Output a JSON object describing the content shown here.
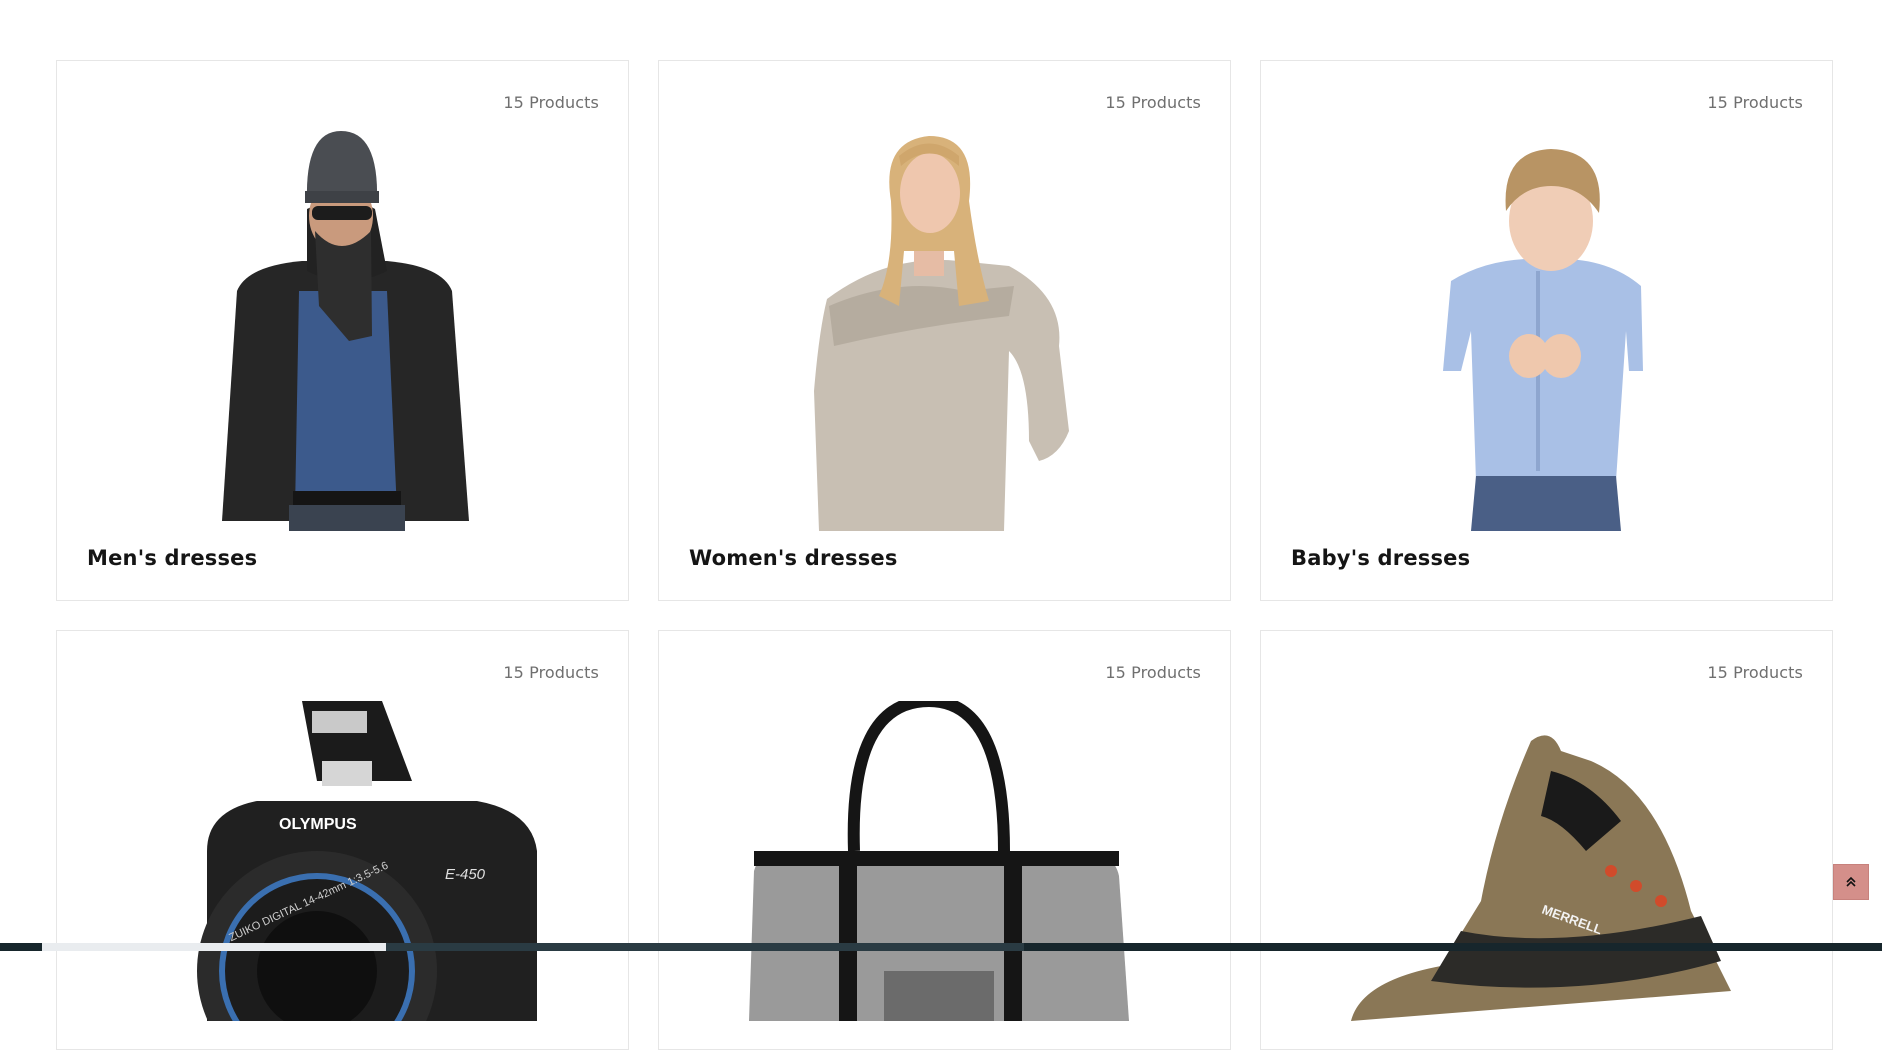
{
  "categories": [
    {
      "count_label": "15 Products",
      "title": "Men's dresses",
      "image_icon": "man-in-jacket-photo"
    },
    {
      "count_label": "15 Products",
      "title": "Women's dresses",
      "image_icon": "woman-in-sweater-photo"
    },
    {
      "count_label": "15 Products",
      "title": "Baby's dresses",
      "image_icon": "boy-in-shirt-photo"
    },
    {
      "count_label": "15 Products",
      "title": "",
      "image_icon": "camera-photo",
      "image_text": {
        "brand": "OLYMPUS",
        "model": "E-450",
        "lens": "ZUIKO DIGITAL 14-42mm 1:3.5-5.6"
      }
    },
    {
      "count_label": "15 Products",
      "title": "",
      "image_icon": "handbag-photo"
    },
    {
      "count_label": "15 Products",
      "title": "",
      "image_icon": "hiking-shoe-photo",
      "image_text": {
        "brand": "MERRELL"
      }
    }
  ],
  "scroll_top": {
    "icon": "double-chevron-up-icon"
  },
  "colors": {
    "card_border": "#e6e6e6",
    "count_text": "#6f6f6f",
    "title_text": "#151515",
    "scroll_top_bg": "#d48f8a",
    "bottom_bar": "#17262c"
  }
}
